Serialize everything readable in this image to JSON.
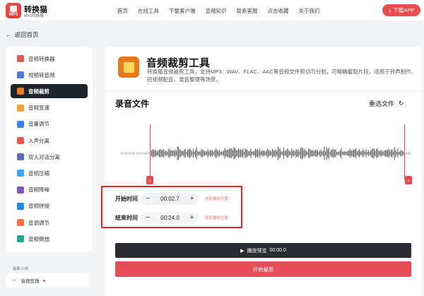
{
  "header": {
    "logo_title": "转换猫",
    "logo_sub": "MP3转换器",
    "logo_mark": "MP3",
    "nav": [
      "首页",
      "在线工具",
      "下载客户端",
      "音频知识",
      "联系客服",
      "点击收藏",
      "关于我们"
    ],
    "download_label": "下载APP"
  },
  "back_label": "返回首页",
  "sidebar": {
    "items": [
      {
        "label": "音频转换器",
        "color": "#e05a5a"
      },
      {
        "label": "视频转音频",
        "color": "#4a7be0"
      },
      {
        "label": "音频裁剪",
        "color": "#e77a1f"
      },
      {
        "label": "音频变速",
        "color": "#f0a23a"
      },
      {
        "label": "音量调节",
        "color": "#3b82f6"
      },
      {
        "label": "人声分离",
        "color": "#ef5350"
      },
      {
        "label": "双人对话分离",
        "color": "#5c6bc0"
      },
      {
        "label": "音频压缩",
        "color": "#42a5f5"
      },
      {
        "label": "音频降噪",
        "color": "#7e57c2"
      },
      {
        "label": "音频拼接",
        "color": "#1e88e5"
      },
      {
        "label": "音调调节",
        "color": "#ff7043"
      },
      {
        "label": "音频倒放",
        "color": "#26a69a"
      }
    ],
    "active_index": 2
  },
  "recent": {
    "label": "最新上线",
    "item": "音频剪辑"
  },
  "tool": {
    "title": "音频裁剪工具",
    "desc": "转换猫音频裁剪工具，支持MP3、WAV、FLAC、AAC等音频文件剪切与分割，可精确截取片段，适用于铃声制作、短视频配音、录音整理等场景。"
  },
  "file_section": {
    "title": "录音文件",
    "reselect": "重选文件"
  },
  "start_time": {
    "label": "开始时间",
    "value": "00:02.7",
    "hint": "选取播放位置"
  },
  "end_time": {
    "label": "结束时间",
    "value": "00:24.0",
    "hint": "选取播放位置"
  },
  "play": {
    "label": "播放预览",
    "time": "00:00.0"
  },
  "start_button": "开始裁剪",
  "colors": {
    "accent": "#e84c4f",
    "dark": "#1f232b",
    "highlight_box": "#e5262c"
  }
}
